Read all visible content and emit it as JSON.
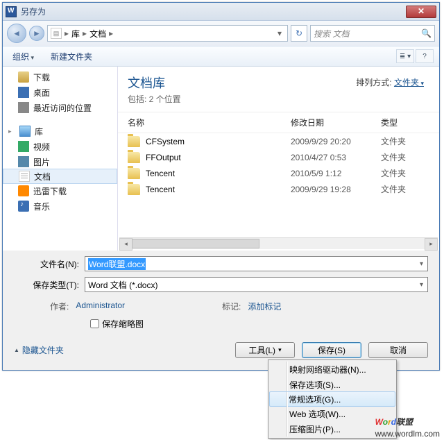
{
  "window": {
    "title": "另存为",
    "close": "✕"
  },
  "nav": {
    "breadcrumb": {
      "root": "库",
      "current": "文档"
    },
    "search_placeholder": "搜索 文档"
  },
  "toolbar": {
    "organize": "组织",
    "newfolder": "新建文件夹"
  },
  "tree": {
    "downloads": "下载",
    "desktop": "桌面",
    "recent": "最近访问的位置",
    "libraries": "库",
    "videos": "视频",
    "pictures": "图片",
    "documents": "文档",
    "thunder": "迅雷下载",
    "music": "音乐"
  },
  "header": {
    "title": "文档库",
    "subtitle": "包括: 2 个位置",
    "arrange_label": "排列方式:",
    "arrange_value": "文件夹"
  },
  "columns": {
    "name": "名称",
    "date": "修改日期",
    "type": "类型"
  },
  "rows": [
    {
      "name": "CFSystem",
      "date": "2009/9/29 20:20",
      "type": "文件夹"
    },
    {
      "name": "FFOutput",
      "date": "2010/4/27 0:53",
      "type": "文件夹"
    },
    {
      "name": "Tencent",
      "date": "2010/5/9 1:12",
      "type": "文件夹"
    },
    {
      "name": "Tencent",
      "date": "2009/9/29 19:28",
      "type": "文件夹"
    }
  ],
  "form": {
    "filename_label": "文件名(N):",
    "filename_value": "Word联盟.docx",
    "savetype_label": "保存类型(T):",
    "savetype_value": "Word 文档 (*.docx)",
    "author_label": "作者:",
    "author_value": "Administrator",
    "tags_label": "标记:",
    "tags_value": "添加标记",
    "thumb_label": "保存缩略图"
  },
  "footer": {
    "hide": "隐藏文件夹",
    "tools": "工具(L)",
    "save": "保存(S)",
    "cancel": "取消"
  },
  "menu": {
    "map": "映射网络驱动器(N)...",
    "saveopts": "保存选项(S)...",
    "general": "常规选项(G)...",
    "web": "Web 选项(W)...",
    "compress": "压缩图片(P)..."
  },
  "watermark": {
    "brand": "Word联盟",
    "url": "www.wordlm.com"
  }
}
